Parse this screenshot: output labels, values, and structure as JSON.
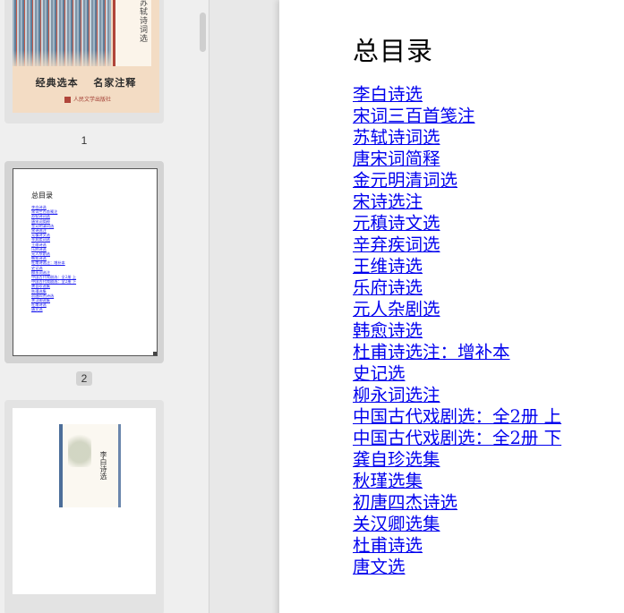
{
  "sidebar": {
    "thumbnails": [
      {
        "page_label": "1",
        "cover": {
          "vertical_title": "苏轼诗词选",
          "slogan": "经典选本 名家注释",
          "publisher": "人民文学出版社"
        }
      },
      {
        "page_label": "2"
      },
      {
        "page_label": "3",
        "cover": {
          "vertical_title": "李白诗选"
        }
      }
    ]
  },
  "document": {
    "title": "总目录",
    "toc": [
      "李白诗选",
      "宋词三百首笺注",
      "苏轼诗词选",
      "唐宋词简释",
      "金元明清词选",
      "宋诗选注",
      "元稹诗文选",
      "辛弃疾词选",
      "王维诗选",
      "乐府诗选",
      "元人杂剧选",
      "韩愈诗选",
      "杜甫诗选注：增补本",
      "史记选",
      "柳永词选注",
      "中国古代戏剧选：全2册 上",
      "中国古代戏剧选：全2册 下",
      "龚自珍选集",
      "秋瑾选集",
      "初唐四杰诗选",
      "关汉卿选集",
      "杜甫诗选",
      "唐文选"
    ]
  },
  "colors": {
    "link": "#0000ee",
    "sidebar_bg": "#efefef",
    "selected_thumb_bg": "#d3d3d3",
    "viewer_bg": "#e8e8e8"
  }
}
